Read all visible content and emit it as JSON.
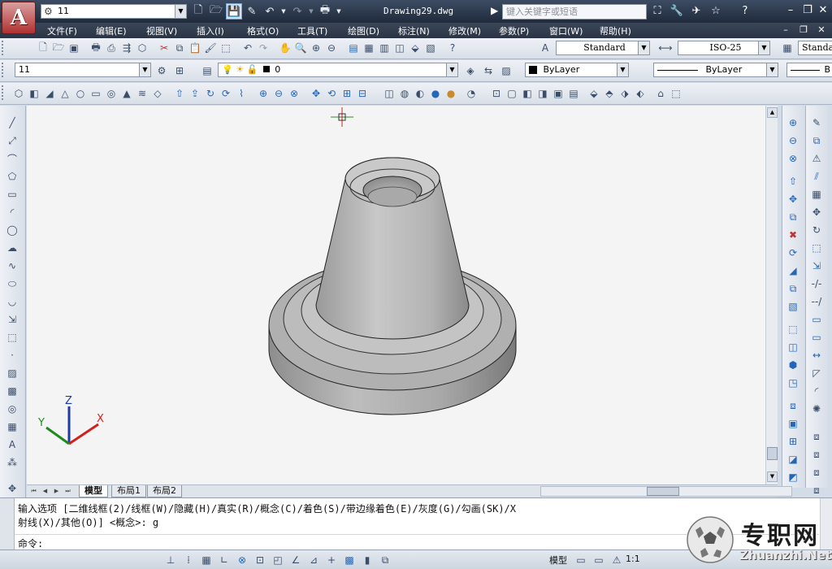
{
  "app": {
    "logo_letter": "A"
  },
  "titlebar": {
    "workspace": "11",
    "document_title": "Drawing29.dwg",
    "search_placeholder": "键入关键字或短语"
  },
  "menu": {
    "items": [
      "文件(F)",
      "编辑(E)",
      "视图(V)",
      "插入(I)",
      "格式(O)",
      "工具(T)",
      "绘图(D)",
      "标注(N)",
      "修改(M)",
      "参数(P)",
      "窗口(W)",
      "帮助(H)"
    ]
  },
  "styles_toolbar": {
    "text_style": "Standard",
    "dim_style": "ISO-25",
    "table_style": "Standard"
  },
  "layers_toolbar": {
    "workspace_combo": "11",
    "layer_name": "0",
    "color": "ByLayer",
    "linetype": "ByLayer",
    "lineweight": "B"
  },
  "layout_tabs": [
    "模型",
    "布局1",
    "布局2"
  ],
  "command": {
    "line1": "输入选项 [二维线框(2)/线框(W)/隐藏(H)/真实(R)/概念(C)/着色(S)/带边缘着色(E)/灰度(G)/勾画(SK)/X",
    "line2": "射线(X)/其他(O)] <概念>: g",
    "prompt": "命令:"
  },
  "statusbar": {
    "model_label": "模型",
    "annotation_scale": "1:1"
  },
  "watermark": {
    "chinese": "专职网",
    "url": "Zhuanzhi.Net"
  },
  "ucs": {
    "x_label": "X",
    "y_label": "Y",
    "z_label": "Z"
  },
  "colors": {
    "title_bg": "#2a3548",
    "toolbar_bg": "#e3e8ef",
    "viewport_bg": "#f4f4f4",
    "model_gray": "#a9a9a9"
  }
}
